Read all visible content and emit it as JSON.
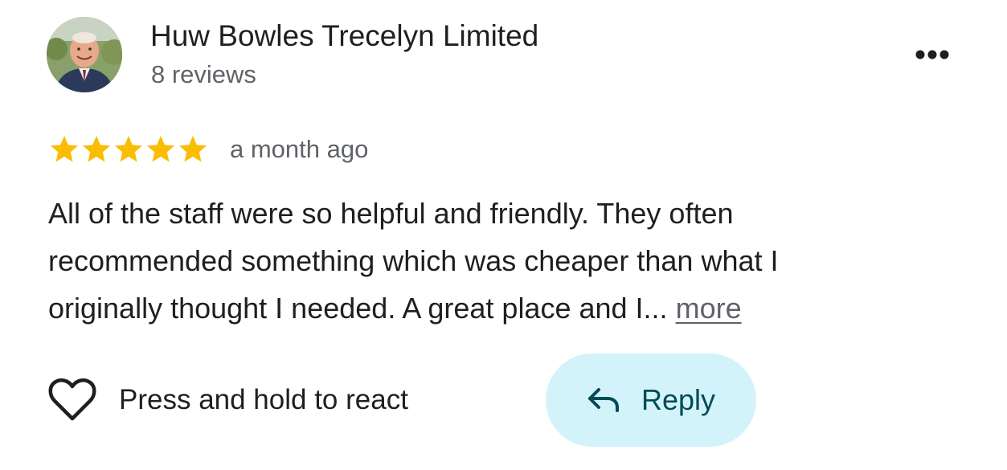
{
  "reviewer": {
    "name": "Huw Bowles Trecelyn Limited",
    "reviews_count": "8 reviews",
    "avatar_icon": "profile-photo"
  },
  "menu": {
    "icon": "more-horizontal-icon"
  },
  "review": {
    "rating": 5,
    "rating_max": 5,
    "star_color": "#fbbc04",
    "time_ago": "a month ago",
    "text_lines": [
      "All of the staff were so helpful and friendly. They often",
      "recommended something which was cheaper than what I",
      "originally thought I needed. A great place and I..."
    ],
    "more_label": "more"
  },
  "actions": {
    "react_label": "Press and hold to react",
    "react_icon": "heart-outline-icon",
    "reply_label": "Reply",
    "reply_icon": "reply-arrow-icon",
    "reply_bg_color": "#d3f3fb",
    "reply_text_color": "#004a58"
  }
}
